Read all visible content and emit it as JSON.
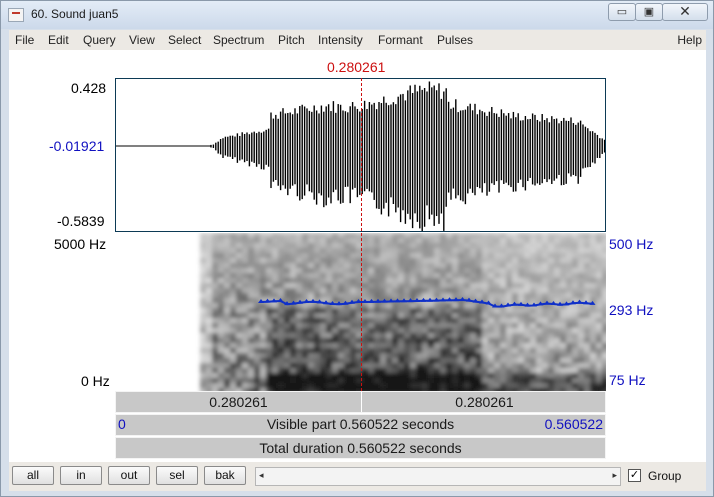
{
  "window": {
    "title": "60. Sound juan5",
    "minimize_glyph": "▭",
    "maximize_glyph": "▣",
    "close_glyph": "✕"
  },
  "menu": {
    "items": [
      "File",
      "Edit",
      "Query",
      "View",
      "Select",
      "Spectrum",
      "Pitch",
      "Intensity",
      "Formant",
      "Pulses"
    ],
    "help": "Help"
  },
  "editor": {
    "cursor_time": "0.280261",
    "sound": {
      "max": "0.428",
      "mid": "-0.01921",
      "min": "-0.5839"
    },
    "spectrogram": {
      "top_freq": "5000 Hz",
      "bottom_freq": "0 Hz"
    },
    "pitch": {
      "top": "500 Hz",
      "current": "293 Hz",
      "bottom": "75 Hz"
    },
    "bar1": {
      "left": "0.280261",
      "right": "0.280261"
    },
    "bar2": {
      "left": "0",
      "center": "Visible part 0.560522 seconds",
      "right": "0.560522"
    },
    "bar3": {
      "text": "Total duration 0.560522 seconds"
    }
  },
  "bottom": {
    "buttons": [
      "all",
      "in",
      "out",
      "sel",
      "bak"
    ],
    "scroll_left": "◂",
    "scroll_right": "▸",
    "group_label": "Group",
    "group_checked": "✓"
  },
  "colors": {
    "cursor": "#cc1010",
    "pitch_line": "#1030c8",
    "axis_blue": "#1010c0"
  }
}
